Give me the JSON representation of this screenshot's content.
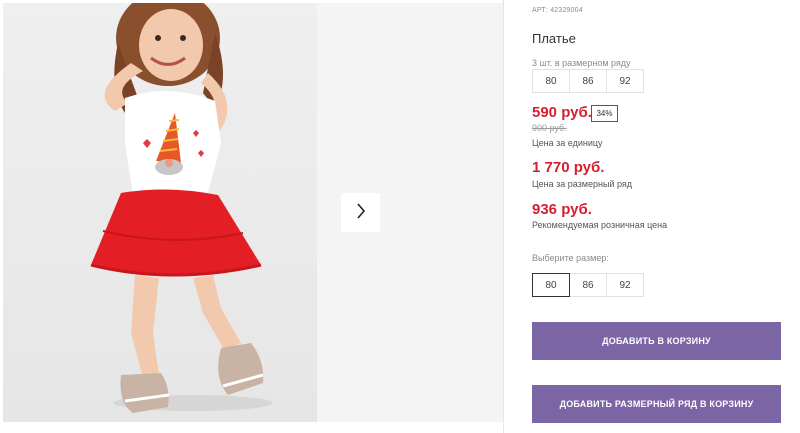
{
  "product": {
    "article": "АРТ: 42329004",
    "title": "Платье"
  },
  "series": {
    "label": "3 шт. в размерном ряду",
    "sizes": [
      "80",
      "86",
      "92"
    ]
  },
  "prices": {
    "current": "590 руб.",
    "discount": "34%",
    "old": "900 руб.",
    "unit_note": "Цена за единицу",
    "series_price": "1 770 руб.",
    "series_note": "Цена за размерный ряд",
    "rrp": "936 руб.",
    "rrp_note": "Рекомендуемая розничная цена"
  },
  "size_picker": {
    "label": "Выберите размер:",
    "sizes": [
      "80",
      "86",
      "92"
    ],
    "selected": "80"
  },
  "actions": {
    "add_to_cart": "ДОБАВИТЬ В КОРЗИНУ",
    "add_series_to_cart": "ДОБАВИТЬ РАЗМЕРНЫЙ РЯД В КОРЗИНУ"
  },
  "colors": {
    "price_red": "#d4202f",
    "button_purple": "#7b65a5"
  },
  "icons": {
    "next": "chevron-right-icon"
  }
}
